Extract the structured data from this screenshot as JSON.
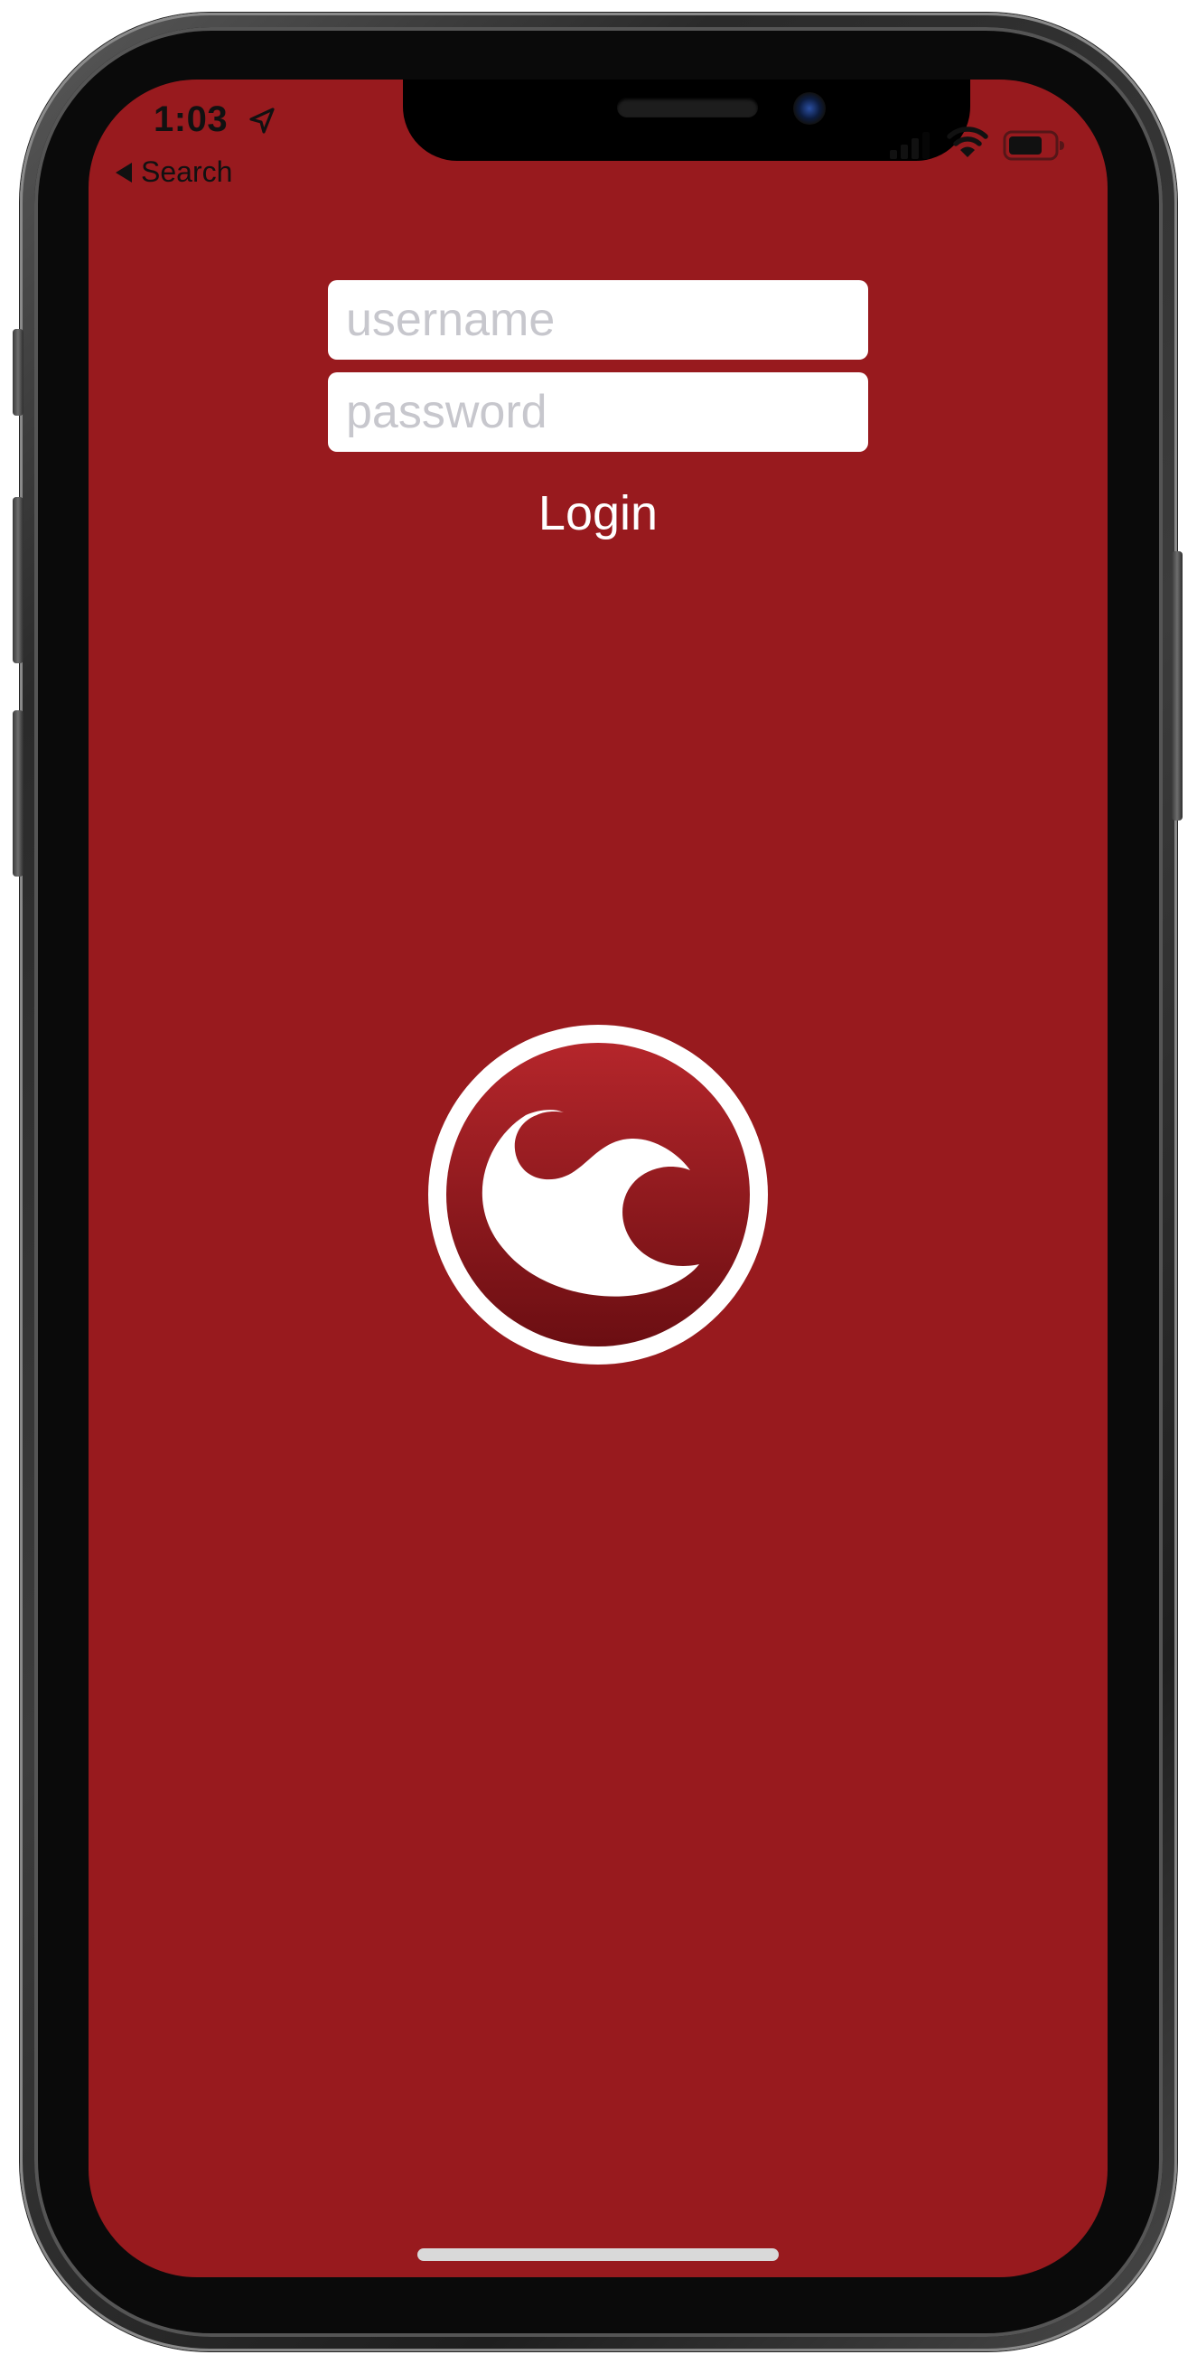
{
  "status_bar": {
    "time": "1:03",
    "back_label": "Search"
  },
  "login_form": {
    "username_placeholder": "username",
    "password_placeholder": "password",
    "login_label": "Login"
  },
  "theme": {
    "background": "#981a1e",
    "field_background": "#ffffff",
    "placeholder_color": "#c7c7cd",
    "text_color": "#ffffff"
  },
  "icons": {
    "location": "location-arrow-icon",
    "signal": "cellular-signal-icon",
    "wifi": "wifi-icon",
    "battery": "battery-icon",
    "logo": "app-logo"
  }
}
